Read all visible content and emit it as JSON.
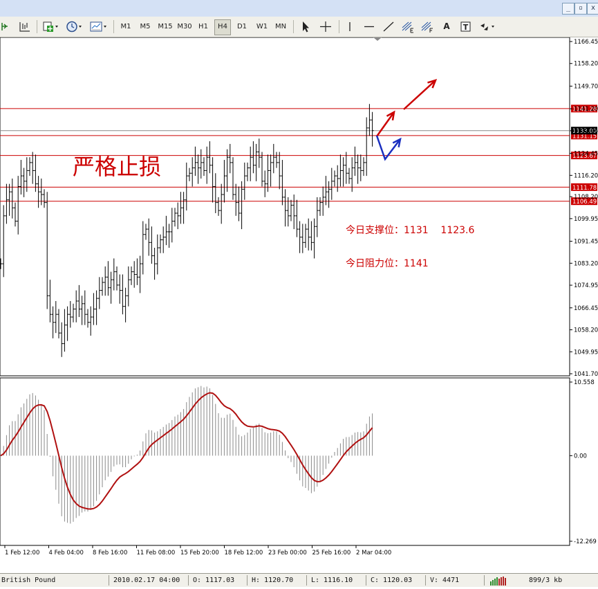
{
  "window": {
    "minimize_glyph": "_",
    "restore_glyph": "▫",
    "close_glyph": "x"
  },
  "toolbar": {
    "timeframes": [
      "M1",
      "M5",
      "M15",
      "M30",
      "H1",
      "H4",
      "D1",
      "W1",
      "MN"
    ],
    "active_timeframe": "H4",
    "icons": [
      "play-icon",
      "chart-add-icon",
      "new-order-icon",
      "clock-icon",
      "template-icon",
      "cursor-icon",
      "crosshair-icon",
      "vertical-line-icon",
      "horizontal-line-icon",
      "trendline-icon",
      "fibonacci-e-icon",
      "fibonacci-f-icon",
      "text-icon",
      "text-label-icon",
      "arrows-icon"
    ],
    "text_tool_glyph": "A",
    "text_label_glyph": "T"
  },
  "chart_data": [
    {
      "type": "candlestick",
      "title": "",
      "y_ticks": [
        "1166.45",
        "1158.20",
        "1149.70",
        "1141.20",
        "1132.95",
        "1124.45",
        "1116.20",
        "1108.20",
        "1099.95",
        "1091.45",
        "1083.20",
        "1074.95",
        "1066.45",
        "1058.20",
        "1049.95",
        "1041.70"
      ],
      "ylim": [
        1041.7,
        1166.45
      ],
      "price_lines": [
        {
          "value": 1141.28,
          "label": "1141.28",
          "color": "#cc0000"
        },
        {
          "value": 1131.15,
          "label": "1131.15",
          "color": "#cc0000"
        },
        {
          "value": 1123.67,
          "label": "1123.67",
          "color": "#cc0000"
        },
        {
          "value": 1111.78,
          "label": "1111.78",
          "color": "#cc0000"
        },
        {
          "value": 1106.49,
          "label": "1106.49",
          "color": "#cc0000"
        }
      ],
      "current_price": {
        "value": 1133.0,
        "label": "1133.00"
      },
      "closes": [
        1083,
        1101,
        1107,
        1110,
        1104,
        1099,
        1112,
        1116,
        1114,
        1118,
        1121,
        1118,
        1113,
        1110,
        1109,
        1106,
        1071,
        1064,
        1061,
        1064,
        1057,
        1053,
        1060,
        1064,
        1063,
        1066,
        1069,
        1066,
        1068,
        1064,
        1061,
        1063,
        1066,
        1070,
        1073,
        1076,
        1078,
        1074,
        1077,
        1080,
        1075,
        1073,
        1067,
        1071,
        1077,
        1080,
        1079,
        1078,
        1083,
        1094,
        1096,
        1091,
        1086,
        1083,
        1089,
        1092,
        1093,
        1095,
        1095,
        1099,
        1102,
        1101,
        1104,
        1107,
        1116,
        1117,
        1119,
        1121,
        1119,
        1121,
        1118,
        1123,
        1120,
        1112,
        1106,
        1103,
        1109,
        1116,
        1123,
        1121,
        1109,
        1106,
        1102,
        1111,
        1116,
        1119,
        1123,
        1120,
        1125,
        1123,
        1114,
        1113,
        1118,
        1121,
        1123,
        1121,
        1116,
        1108,
        1103,
        1101,
        1105,
        1101,
        1096,
        1093,
        1091,
        1096,
        1093,
        1091,
        1097,
        1103,
        1106,
        1108,
        1110,
        1111,
        1114,
        1116,
        1115,
        1118,
        1120,
        1117,
        1115,
        1119,
        1121,
        1119,
        1118,
        1121,
        1134,
        1137,
        1133
      ],
      "x_labels": [
        "1 Feb 12:00",
        "4 Feb 04:00",
        "8 Feb 16:00",
        "11 Feb 08:00",
        "15 Feb 20:00",
        "18 Feb 12:00",
        "23 Feb 00:00",
        "25 Feb 16:00",
        "2 Mar 04:00"
      ],
      "annotations": [
        {
          "text": "严格止损",
          "color": "#cc0000"
        },
        {
          "text": "今日支撑位：1131    1123.6",
          "color": "#cc0000"
        },
        {
          "text": "今日阻力位：1141",
          "color": "#cc0000"
        }
      ]
    },
    {
      "type": "macd",
      "y_ticks": [
        "10.558",
        "0.00",
        "-12.269"
      ],
      "ylim": [
        -12.269,
        10.558
      ],
      "signal_color": "#b01010"
    }
  ],
  "status": {
    "symbol": "British Pound",
    "datetime": "2010.02.17 04:00",
    "open": "O: 1117.03",
    "high": "H: 1120.70",
    "low": "L: 1116.10",
    "close": "C: 1120.03",
    "volume": "V: 4471",
    "traffic": "899/3 kb"
  }
}
